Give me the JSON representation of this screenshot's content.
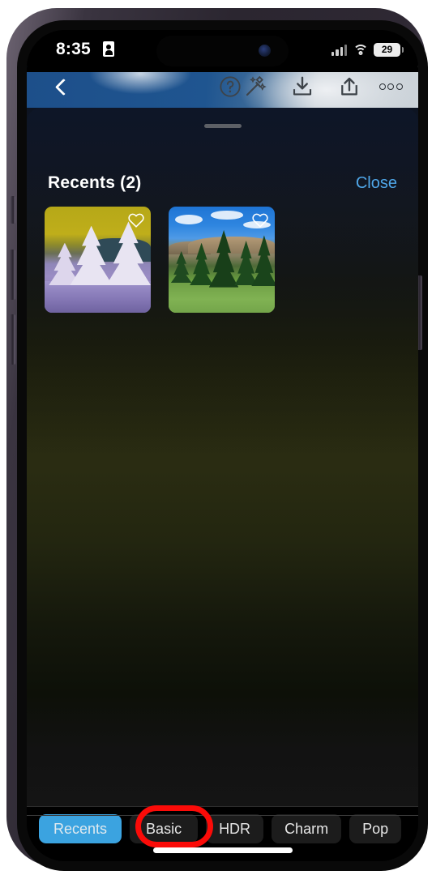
{
  "device": {
    "status_bar": {
      "time": "8:35",
      "location_icon": "location-arrow-icon",
      "cellular_icon": "cellular-signal-icon",
      "wifi_icon": "wifi-icon",
      "battery_level": "29"
    },
    "home_indicator": "home-indicator"
  },
  "app_toolbar": {
    "back_icon": "chevron-left-icon",
    "help_icon": "question-mark-icon",
    "magic_icon": "magic-wand-icon",
    "download_icon": "download-icon",
    "share_icon": "share-upload-icon",
    "more_icon": "more-dots-icon"
  },
  "recents_sheet": {
    "handle": "drag-handle",
    "title": "Recents (2)",
    "close_label": "Close",
    "thumbnails": [
      {
        "name": "inverted-forest-thumbnail",
        "favorite_icon": "heart-icon"
      },
      {
        "name": "mountain-forest-thumbnail",
        "favorite_icon": "heart-icon"
      }
    ]
  },
  "tab_bar": {
    "tabs": [
      {
        "label": "Recents",
        "active": true
      },
      {
        "label": "Basic",
        "active": false,
        "annotated": true
      },
      {
        "label": "HDR",
        "active": false
      },
      {
        "label": "Charm",
        "active": false
      },
      {
        "label": "Pop",
        "active": false
      }
    ]
  },
  "colors": {
    "accent_blue": "#3ba3e0",
    "close_link_blue": "#4fa6e8",
    "annotation_red": "#fb0b08",
    "tab_inactive_bg": "#1c1c1c",
    "panel_black": "#000000"
  }
}
